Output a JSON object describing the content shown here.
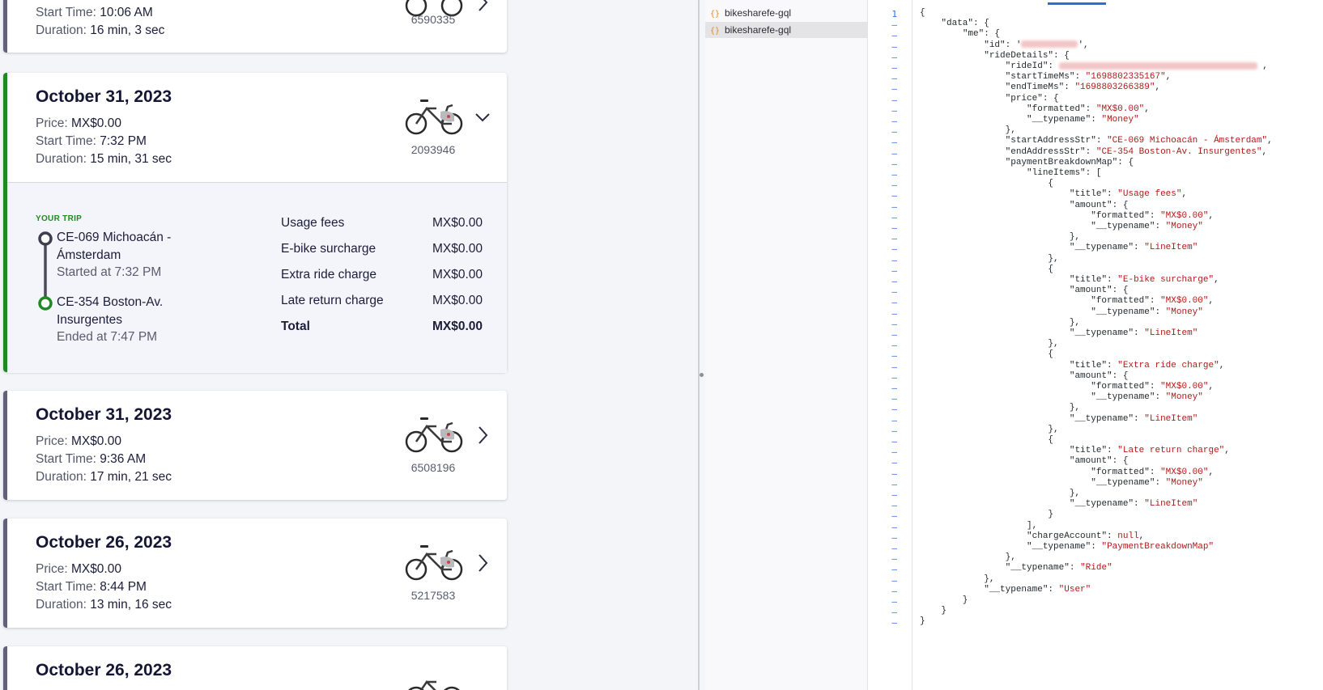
{
  "rides_top": {
    "partial_start_label": "Start Time:",
    "partial_start_value": "10:06 AM",
    "partial_duration_label": "Duration:",
    "partial_duration_value": "16 min, 3 sec",
    "partial_bike_id": "6590335"
  },
  "labels": {
    "price": "Price:",
    "start": "Start Time:",
    "duration": "Duration:"
  },
  "expanded_ride": {
    "date": "October 31, 2023",
    "price": "MX$0.00",
    "start": "7:32 PM",
    "duration": "15 min, 31 sec",
    "bike_id": "2093946",
    "your_trip_label": "YOUR TRIP",
    "start_station": "CE-069 Michoacán - Ámsterdam",
    "started_at": "Started at 7:32 PM",
    "end_station": "CE-354 Boston-Av. Insurgentes",
    "ended_at": "Ended at 7:47 PM",
    "fees": [
      {
        "label": "Usage fees",
        "amount": "MX$0.00"
      },
      {
        "label": "E-bike surcharge",
        "amount": "MX$0.00"
      },
      {
        "label": "Extra ride charge",
        "amount": "MX$0.00"
      },
      {
        "label": "Late return charge",
        "amount": "MX$0.00"
      }
    ],
    "total_label": "Total",
    "total_amount": "MX$0.00"
  },
  "rides": [
    {
      "date": "October 31, 2023",
      "price": "MX$0.00",
      "start": "9:36 AM",
      "duration": "17 min, 21 sec",
      "bike_id": "6508196"
    },
    {
      "date": "October 26, 2023",
      "price": "MX$0.00",
      "start": "8:44 PM",
      "duration": "13 min, 16 sec",
      "bike_id": "5217583"
    },
    {
      "date": "October 26, 2023"
    }
  ],
  "files": [
    {
      "name": "bikesharefe-gql"
    },
    {
      "name": "bikesharefe-gql"
    }
  ],
  "icons": {
    "file": "json-file-icon",
    "bike": "bike-icon",
    "chevron": "chevron-icon"
  },
  "colors": {
    "active": "#1f8a24",
    "inactive": "#62607a",
    "string": "#b01a1a",
    "linenum": "#2b6fd6"
  },
  "code": {
    "line1_number": "1",
    "lines": [
      "{",
      "    \"data\": {",
      "        \"me\": {",
      "            \"id\": '",
      "            \"rideDetails\": {",
      "                \"rideId\": ",
      "                \"startTimeMs\": \"1698802335167\",",
      "                \"endTimeMs\": \"1698803266389\",",
      "                \"price\": {",
      "                    \"formatted\": \"MX$0.00\",",
      "                    \"__typename\": \"Money\"",
      "                },",
      "                \"startAddressStr\": \"CE-069 Michoacán - Ámsterdam\",",
      "                \"endAddressStr\": \"CE-354 Boston-Av. Insurgentes\",",
      "                \"paymentBreakdownMap\": {",
      "                    \"lineItems\": [",
      "                        {",
      "                            \"title\": \"Usage fees\",",
      "                            \"amount\": {",
      "                                \"formatted\": \"MX$0.00\",",
      "                                \"__typename\": \"Money\"",
      "                            },",
      "                            \"__typename\": \"LineItem\"",
      "                        },",
      "                        {",
      "                            \"title\": \"E-bike surcharge\",",
      "                            \"amount\": {",
      "                                \"formatted\": \"MX$0.00\",",
      "                                \"__typename\": \"Money\"",
      "                            },",
      "                            \"__typename\": \"LineItem\"",
      "                        },",
      "                        {",
      "                            \"title\": \"Extra ride charge\",",
      "                            \"amount\": {",
      "                                \"formatted\": \"MX$0.00\",",
      "                                \"__typename\": \"Money\"",
      "                            },",
      "                            \"__typename\": \"LineItem\"",
      "                        },",
      "                        {",
      "                            \"title\": \"Late return charge\",",
      "                            \"amount\": {",
      "                                \"formatted\": \"MX$0.00\",",
      "                                \"__typename\": \"Money\"",
      "                            },",
      "                            \"__typename\": \"LineItem\"",
      "                        }",
      "                    ],",
      "                    \"chargeAccount\": null,",
      "                    \"__typename\": \"PaymentBreakdownMap\"",
      "                },",
      "                \"__typename\": \"Ride\"",
      "            },",
      "            \"__typename\": \"User\"",
      "        }",
      "    }",
      "}"
    ]
  }
}
